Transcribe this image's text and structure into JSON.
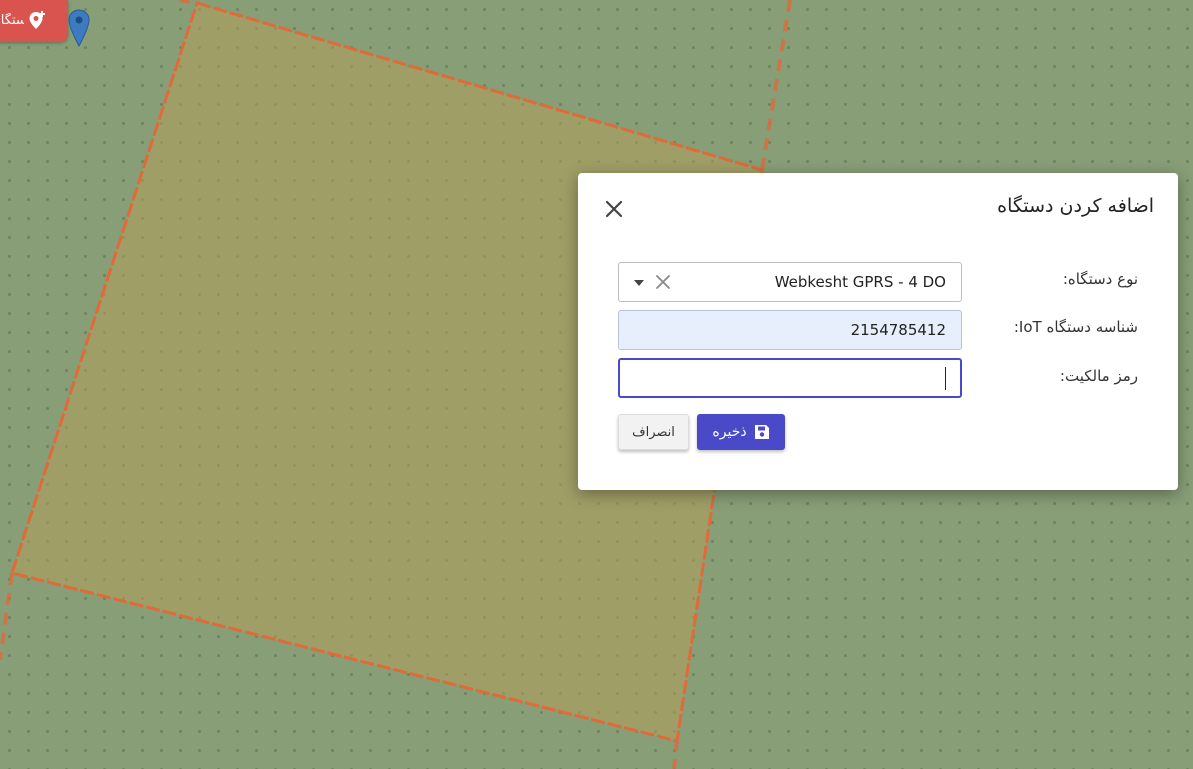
{
  "map": {
    "add_device_chip_label": "دستگاه",
    "add_device_icon": "map-pin-plus-icon",
    "marker_icon": "map-marker-icon",
    "field_fill_color": "#b39f59",
    "boundary_color": "#e06a3a"
  },
  "dialog": {
    "title": "اضافه کردن دستگاه",
    "close_icon": "close-icon",
    "device_type": {
      "label": "نوع دستگاه:",
      "value": "Webkesht GPRS - 4 DO",
      "clear_icon": "clear-icon",
      "arrow_icon": "dropdown-arrow-icon"
    },
    "iot_id": {
      "label": "شناسه دستگاه IoT:",
      "value": "2154785412"
    },
    "ownership_password": {
      "label": "رمز مالکیت:",
      "value": ""
    },
    "save_button": {
      "label": "ذخیره",
      "icon": "save-icon"
    },
    "cancel_button": {
      "label": "انصراف"
    },
    "accent_color": "#4a49c8"
  }
}
